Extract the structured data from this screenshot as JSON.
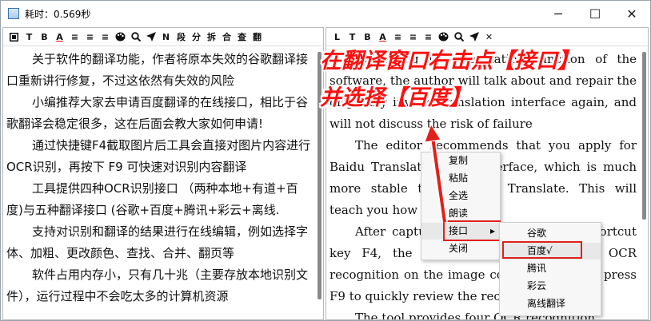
{
  "window": {
    "title": "耗时：0.569秒",
    "controls": {
      "minimize": "─",
      "maximize": "☐",
      "close": "✕"
    }
  },
  "left_toolbar": [
    "P",
    "T",
    "B",
    "A",
    "≡",
    "≡",
    "≡",
    "palette",
    "search",
    "send",
    "N",
    "段",
    "分",
    "拆",
    "合",
    "查",
    "翻"
  ],
  "right_toolbar": [
    "L",
    "T",
    "B",
    "A",
    "≡",
    "≡",
    "≡",
    "palette",
    "search",
    "send",
    "✕"
  ],
  "left_text": [
    "关于软件的翻译功能，作者将原本失效的谷歌翻译接口重新讲行修复，不过这依然有失效的风险",
    "小编推荐大家去申请百度翻译的在线接口，相比于谷歌翻译会稳定很多，这在后面会教大家如何申请!",
    "通过快捷键F4截取图片后工具会直接对图片内容进行OCR识别，再按下 F9 可快速对识别内容翻译",
    "工具提供四种OCR识别接口 （两种本地+有道+百度)与五种翻译接口 (谷歌+百度+腾讯+彩云+离线.",
    "支持对识别和翻译的结果进行在线编辑，例如选择字体、加粗、更改颜色、查找、合并、翻页等",
    "软件占用内存小，只有几十兆（主要存放本地识别文件），运行过程中不会吃太多的计算机资源"
  ],
  "right_text": [
    "Regarding the translation function of the software, the author will talk about and repair the originally invalid translation interface again, and will not discuss the risk of failure",
    "The editor recommends that you apply for Baidu Translate online interface, which is much more stable than Google Translate. This will teach you how to apply!",
    "After capturing the image with the shortcut key F4, the tool will directly perform OCR recognition on the image content, and then press F9 to quickly review the recognized content",
    "The tool provides four OCR recognition"
  ],
  "context_menu": {
    "items": [
      "复制",
      "粘贴",
      "全选",
      "朗读",
      "接口",
      "关闭"
    ],
    "submenu_arrow": "▸"
  },
  "submenu": {
    "items": [
      "谷歌",
      "百度√",
      "腾讯",
      "彩云",
      "离线翻译"
    ]
  },
  "annotation": {
    "line1": "在翻译窗口右击点【接口】",
    "line2": "并选择【百度】",
    "color": "#ff0f0f"
  }
}
